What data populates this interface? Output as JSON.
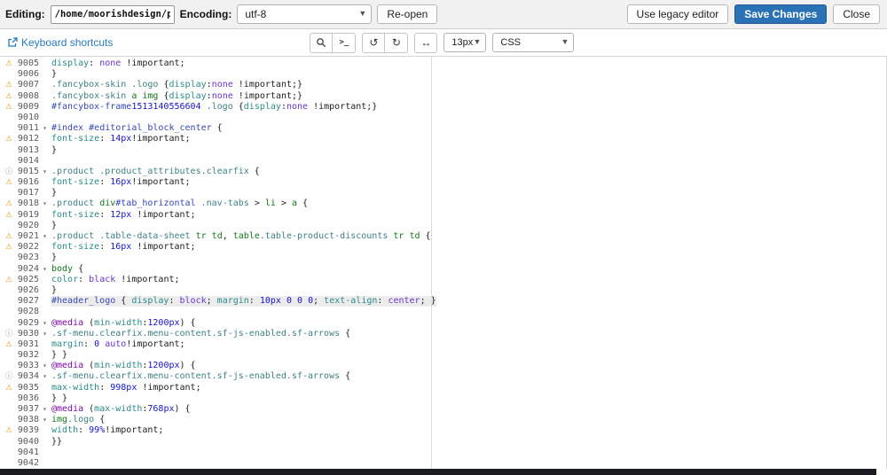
{
  "header": {
    "editing_label": "Editing:",
    "path_value": "/home/moorishdesign/pu",
    "encoding_label": "Encoding:",
    "encoding_value": "utf-8",
    "reopen_button": "Re-open",
    "legacy_button": "Use legacy editor",
    "save_button": "Save Changes",
    "close_button": "Close"
  },
  "toolbar": {
    "shortcuts_label": "Keyboard shortcuts",
    "terminal_glyph": ">_",
    "undo_glyph": "↺",
    "redo_glyph": "↻",
    "wrap_glyph": "↔",
    "font_size_value": "13px",
    "mode_value": "CSS"
  },
  "colors": {
    "accent_blue": "#2779bd",
    "primary_button_blue": "#2a72b5",
    "warning_marker": "#e2a32e",
    "info_marker": "#8a8a8a",
    "active_line_bg": "#ececec"
  },
  "editor": {
    "lines": [
      {
        "num": "9005",
        "marker": "warning",
        "tokens": [
          [
            "p",
            "display"
          ],
          [
            "x",
            ": "
          ],
          [
            "a",
            "none"
          ],
          [
            "x",
            " !important;"
          ]
        ]
      },
      {
        "num": "9006",
        "tokens": [
          [
            "x",
            "}"
          ]
        ]
      },
      {
        "num": "9007",
        "marker": "warning",
        "tokens": [
          [
            "c",
            ".fancybox-skin"
          ],
          [
            "x",
            " "
          ],
          [
            "c",
            ".logo"
          ],
          [
            "x",
            " {"
          ],
          [
            "p",
            "display"
          ],
          [
            "x",
            ":"
          ],
          [
            "a",
            "none"
          ],
          [
            "x",
            " !important;}"
          ]
        ]
      },
      {
        "num": "9008",
        "marker": "warning",
        "tokens": [
          [
            "c",
            ".fancybox-skin"
          ],
          [
            "x",
            " "
          ],
          [
            "t",
            "a"
          ],
          [
            "x",
            " "
          ],
          [
            "t",
            "img"
          ],
          [
            "x",
            " {"
          ],
          [
            "p",
            "display"
          ],
          [
            "x",
            ":"
          ],
          [
            "a",
            "none"
          ],
          [
            "x",
            " !important;}"
          ]
        ]
      },
      {
        "num": "9009",
        "marker": "warning",
        "tokens": [
          [
            "i",
            "#fancybox-frame"
          ],
          [
            "n",
            "1513140556604"
          ],
          [
            "x",
            " "
          ],
          [
            "c",
            ".logo"
          ],
          [
            "x",
            " {"
          ],
          [
            "p",
            "display"
          ],
          [
            "x",
            ":"
          ],
          [
            "a",
            "none"
          ],
          [
            "x",
            " !important;}"
          ]
        ]
      },
      {
        "num": "9010",
        "tokens": []
      },
      {
        "num": "9011",
        "fold": true,
        "tokens": [
          [
            "i",
            "#index"
          ],
          [
            "x",
            " "
          ],
          [
            "i",
            "#editorial_block_center"
          ],
          [
            "x",
            " {"
          ]
        ]
      },
      {
        "num": "9012",
        "marker": "warning",
        "tokens": [
          [
            "p",
            "font-size"
          ],
          [
            "x",
            ": "
          ],
          [
            "n",
            "14px"
          ],
          [
            "x",
            "!important;"
          ]
        ]
      },
      {
        "num": "9013",
        "tokens": [
          [
            "x",
            "}"
          ]
        ]
      },
      {
        "num": "9014",
        "tokens": []
      },
      {
        "num": "9015",
        "marker": "info",
        "fold": true,
        "tokens": [
          [
            "c",
            ".product"
          ],
          [
            "x",
            " "
          ],
          [
            "c",
            ".product_attributes.clearfix"
          ],
          [
            "x",
            " {"
          ]
        ]
      },
      {
        "num": "9016",
        "marker": "warning",
        "tokens": [
          [
            "p",
            "font-size"
          ],
          [
            "x",
            ": "
          ],
          [
            "n",
            "16px"
          ],
          [
            "x",
            "!important;"
          ]
        ]
      },
      {
        "num": "9017",
        "tokens": [
          [
            "x",
            "}"
          ]
        ]
      },
      {
        "num": "9018",
        "marker": "warning",
        "fold": true,
        "tokens": [
          [
            "c",
            ".product"
          ],
          [
            "x",
            " "
          ],
          [
            "t",
            "div"
          ],
          [
            "i",
            "#tab_horizontal"
          ],
          [
            "x",
            " "
          ],
          [
            "c",
            ".nav-tabs"
          ],
          [
            "x",
            " > "
          ],
          [
            "t",
            "li"
          ],
          [
            "x",
            " > "
          ],
          [
            "t",
            "a"
          ],
          [
            "x",
            " {"
          ]
        ]
      },
      {
        "num": "9019",
        "marker": "warning",
        "tokens": [
          [
            "p",
            "font-size"
          ],
          [
            "x",
            ": "
          ],
          [
            "n",
            "12px"
          ],
          [
            "x",
            " !important;"
          ]
        ]
      },
      {
        "num": "9020",
        "tokens": [
          [
            "x",
            "}"
          ]
        ]
      },
      {
        "num": "9021",
        "marker": "warning",
        "fold": true,
        "tokens": [
          [
            "c",
            ".product"
          ],
          [
            "x",
            " "
          ],
          [
            "c",
            ".table-data-sheet"
          ],
          [
            "x",
            " "
          ],
          [
            "t",
            "tr"
          ],
          [
            "x",
            " "
          ],
          [
            "t",
            "td"
          ],
          [
            "x",
            ", "
          ],
          [
            "t",
            "table"
          ],
          [
            "c",
            ".table-product-discounts"
          ],
          [
            "x",
            " "
          ],
          [
            "t",
            "tr"
          ],
          [
            "x",
            " "
          ],
          [
            "t",
            "td"
          ],
          [
            "x",
            " {"
          ]
        ]
      },
      {
        "num": "9022",
        "marker": "warning",
        "tokens": [
          [
            "p",
            "font-size"
          ],
          [
            "x",
            ": "
          ],
          [
            "n",
            "16px"
          ],
          [
            "x",
            " !important;"
          ]
        ]
      },
      {
        "num": "9023",
        "tokens": [
          [
            "x",
            "}"
          ]
        ]
      },
      {
        "num": "9024",
        "fold": true,
        "tokens": [
          [
            "t",
            "body"
          ],
          [
            "x",
            " {"
          ]
        ]
      },
      {
        "num": "9025",
        "marker": "warning",
        "tokens": [
          [
            "p",
            "color"
          ],
          [
            "x",
            ": "
          ],
          [
            "a",
            "black"
          ],
          [
            "x",
            " !important;"
          ]
        ]
      },
      {
        "num": "9026",
        "tokens": [
          [
            "x",
            "}"
          ]
        ]
      },
      {
        "num": "9027",
        "active": true,
        "tokens": [
          [
            "i",
            "#header_logo"
          ],
          [
            "x",
            " { "
          ],
          [
            "p",
            "display"
          ],
          [
            "x",
            ": "
          ],
          [
            "a",
            "block"
          ],
          [
            "x",
            "; "
          ],
          [
            "p",
            "margin"
          ],
          [
            "x",
            ": "
          ],
          [
            "n",
            "10px"
          ],
          [
            "x",
            " "
          ],
          [
            "n",
            "0"
          ],
          [
            "x",
            " "
          ],
          [
            "n",
            "0"
          ],
          [
            "x",
            " "
          ],
          [
            "n",
            "0"
          ],
          [
            "x",
            "; "
          ],
          [
            "p",
            "text-align"
          ],
          [
            "x",
            ": "
          ],
          [
            "a",
            "center"
          ],
          [
            "x",
            "; }"
          ]
        ]
      },
      {
        "num": "9028",
        "tokens": []
      },
      {
        "num": "9029",
        "fold": true,
        "tokens": [
          [
            "k",
            "@media"
          ],
          [
            "x",
            " ("
          ],
          [
            "p",
            "min-width"
          ],
          [
            "x",
            ":"
          ],
          [
            "n",
            "1200px"
          ],
          [
            "x",
            ") {"
          ]
        ]
      },
      {
        "num": "9030",
        "marker": "info",
        "fold": true,
        "tokens": [
          [
            "c",
            ".sf-menu.clearfix.menu-content.sf-js-enabled.sf-arrows"
          ],
          [
            "x",
            " {"
          ]
        ]
      },
      {
        "num": "9031",
        "marker": "warning",
        "tokens": [
          [
            "p",
            "margin"
          ],
          [
            "x",
            ": "
          ],
          [
            "n",
            "0"
          ],
          [
            "x",
            " "
          ],
          [
            "a",
            "auto"
          ],
          [
            "x",
            "!important;"
          ]
        ]
      },
      {
        "num": "9032",
        "tokens": [
          [
            "x",
            "} }"
          ]
        ]
      },
      {
        "num": "9033",
        "fold": true,
        "tokens": [
          [
            "k",
            "@media"
          ],
          [
            "x",
            " ("
          ],
          [
            "p",
            "min-width"
          ],
          [
            "x",
            ":"
          ],
          [
            "n",
            "1200px"
          ],
          [
            "x",
            ") {"
          ]
        ]
      },
      {
        "num": "9034",
        "marker": "info",
        "fold": true,
        "tokens": [
          [
            "c",
            ".sf-menu.clearfix.menu-content.sf-js-enabled.sf-arrows"
          ],
          [
            "x",
            " {"
          ]
        ]
      },
      {
        "num": "9035",
        "marker": "warning",
        "tokens": [
          [
            "p",
            "max-width"
          ],
          [
            "x",
            ": "
          ],
          [
            "n",
            "998px"
          ],
          [
            "x",
            " !important;"
          ]
        ]
      },
      {
        "num": "9036",
        "tokens": [
          [
            "x",
            "} }"
          ]
        ]
      },
      {
        "num": "9037",
        "fold": true,
        "tokens": [
          [
            "k",
            "@media"
          ],
          [
            "x",
            " ("
          ],
          [
            "p",
            "max-width"
          ],
          [
            "x",
            ":"
          ],
          [
            "n",
            "768px"
          ],
          [
            "x",
            ") {"
          ]
        ]
      },
      {
        "num": "9038",
        "fold": true,
        "tokens": [
          [
            "t",
            "img"
          ],
          [
            "c",
            ".logo"
          ],
          [
            "x",
            " {"
          ]
        ]
      },
      {
        "num": "9039",
        "marker": "warning",
        "tokens": [
          [
            "p",
            "width"
          ],
          [
            "x",
            ": "
          ],
          [
            "n",
            "99%"
          ],
          [
            "x",
            "!important;"
          ]
        ]
      },
      {
        "num": "9040",
        "tokens": [
          [
            "x",
            "}}"
          ]
        ]
      },
      {
        "num": "9041",
        "tokens": []
      },
      {
        "num": "9042",
        "tokens": []
      }
    ]
  }
}
